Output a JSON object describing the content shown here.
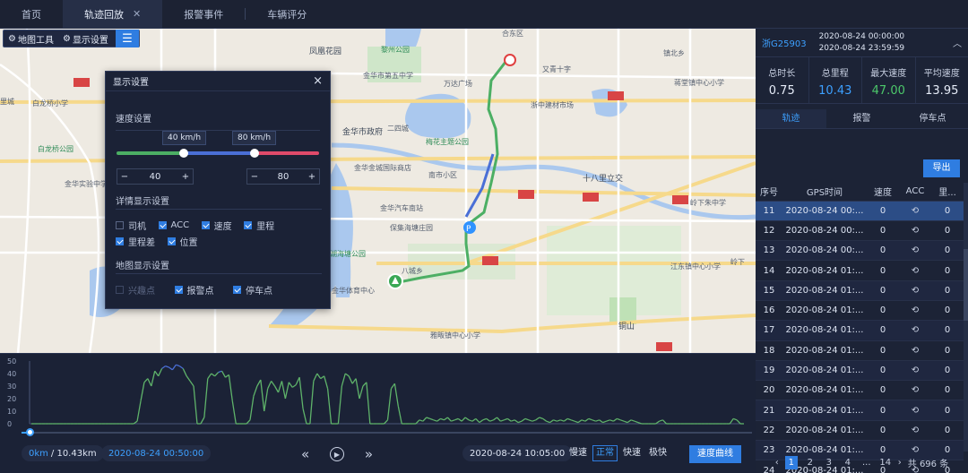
{
  "tabs": [
    {
      "label": "首页",
      "active": false
    },
    {
      "label": "轨迹回放",
      "active": true,
      "closable": true
    },
    {
      "label": "报警事件",
      "active": false
    },
    {
      "label": "车辆评分",
      "active": false
    }
  ],
  "map_toolbar": {
    "map_tools": "地图工具",
    "display_settings": "显示设置"
  },
  "map_labels": [
    "凤凰花园",
    "黎州公园",
    "合东区",
    "金华市第五中学",
    "又青十字",
    "万达广场",
    "浙中建材市场",
    "金华市政府",
    "二四城",
    "梅花主题公园",
    "金华金城国际商店",
    "南市小区",
    "十八里立交",
    "保集海塘庄园",
    "湖海塘公园",
    "金华汽车南站",
    "八城乡",
    "金华体育中心",
    "雅畈镇中心小学",
    "岭下朱中学",
    "岭下",
    "江东镇中心小学",
    "镇北乡",
    "铜山",
    "白龙桥小学",
    "金华实验中学",
    "白龙桥公园",
    "里城",
    "蒋堂镇中心小学"
  ],
  "settings_panel": {
    "title": "显示设置",
    "close": "×",
    "speed_title": "速度设置",
    "low_bubble": "40 km/h",
    "high_bubble": "80 km/h",
    "low_value": "40",
    "high_value": "80",
    "detail_title": "详情显示设置",
    "detail_items": [
      {
        "label": "司机",
        "checked": false
      },
      {
        "label": "ACC",
        "checked": true
      },
      {
        "label": "速度",
        "checked": true
      },
      {
        "label": "里程",
        "checked": true
      },
      {
        "label": "里程差",
        "checked": true
      },
      {
        "label": "位置",
        "checked": true
      }
    ],
    "map_title": "地图显示设置",
    "map_items": [
      {
        "label": "兴趣点",
        "checked": false,
        "disabled": true
      },
      {
        "label": "报警点",
        "checked": true
      },
      {
        "label": "停车点",
        "checked": true
      }
    ]
  },
  "vehicle": {
    "plate": "浙G25903",
    "start_time": "2020-08-24 00:00:00",
    "end_time": "2020-08-24 23:59:59"
  },
  "stats": [
    {
      "label": "总时长",
      "value": "0.75",
      "color": "#e6ecf8"
    },
    {
      "label": "总里程",
      "value": "10.43",
      "color": "#3da0ff"
    },
    {
      "label": "最大速度",
      "value": "47.00",
      "color": "#4cc76a"
    },
    {
      "label": "平均速度",
      "value": "13.95",
      "color": "#e6ecf8"
    }
  ],
  "panel_tabs": [
    {
      "label": "轨迹",
      "active": true
    },
    {
      "label": "报警",
      "active": false
    },
    {
      "label": "停车点",
      "active": false
    }
  ],
  "export_label": "导出",
  "table": {
    "headers": [
      "序号",
      "GPS时间",
      "速度",
      "ACC",
      "里..."
    ],
    "rows": [
      {
        "no": "11",
        "time": "2020-08-24 00:...",
        "speed": "0",
        "mileage": "0",
        "selected": true
      },
      {
        "no": "12",
        "time": "2020-08-24 00:...",
        "speed": "0",
        "mileage": "0"
      },
      {
        "no": "13",
        "time": "2020-08-24 00:...",
        "speed": "0",
        "mileage": "0"
      },
      {
        "no": "14",
        "time": "2020-08-24 01:...",
        "speed": "0",
        "mileage": "0"
      },
      {
        "no": "15",
        "time": "2020-08-24 01:...",
        "speed": "0",
        "mileage": "0"
      },
      {
        "no": "16",
        "time": "2020-08-24 01:...",
        "speed": "0",
        "mileage": "0"
      },
      {
        "no": "17",
        "time": "2020-08-24 01:...",
        "speed": "0",
        "mileage": "0"
      },
      {
        "no": "18",
        "time": "2020-08-24 01:...",
        "speed": "0",
        "mileage": "0"
      },
      {
        "no": "19",
        "time": "2020-08-24 01:...",
        "speed": "0",
        "mileage": "0"
      },
      {
        "no": "20",
        "time": "2020-08-24 01:...",
        "speed": "0",
        "mileage": "0"
      },
      {
        "no": "21",
        "time": "2020-08-24 01:...",
        "speed": "0",
        "mileage": "0"
      },
      {
        "no": "22",
        "time": "2020-08-24 01:...",
        "speed": "0",
        "mileage": "0"
      },
      {
        "no": "23",
        "time": "2020-08-24 01:...",
        "speed": "0",
        "mileage": "0"
      },
      {
        "no": "24",
        "time": "2020-08-24 01:...",
        "speed": "0",
        "mileage": "0"
      }
    ]
  },
  "pager": {
    "pages": [
      "1",
      "2",
      "3",
      "4",
      "...",
      "14"
    ],
    "active": "1",
    "total": "共 696 条"
  },
  "playback": {
    "mileage_progress": "0km",
    "mileage_total": "/ 10.43km",
    "current_time": "2020-08-24 00:50:00",
    "end_time": "2020-08-24 10:05:00",
    "speeds": [
      {
        "label": "慢速",
        "active": false
      },
      {
        "label": "正常",
        "active": true
      },
      {
        "label": "快速",
        "active": false
      },
      {
        "label": "极快",
        "active": false
      }
    ],
    "curve_button": "速度曲线",
    "progress": 0.02
  },
  "chart_data": {
    "type": "line",
    "title": "",
    "ylim": [
      0,
      50
    ],
    "yticks": [
      "50",
      "40",
      "30",
      "20",
      "10",
      "0"
    ],
    "series": [
      {
        "values": [
          0,
          0,
          0,
          0,
          0,
          0,
          0,
          0,
          0,
          0,
          0,
          0,
          0,
          0,
          0,
          0,
          0,
          0,
          0,
          0,
          0,
          0,
          0,
          0,
          0,
          0,
          0,
          0,
          0,
          0,
          2,
          18,
          33,
          36,
          30,
          42,
          38,
          44,
          46,
          45,
          43,
          47,
          46,
          44,
          38,
          34,
          30,
          0,
          0,
          5,
          36,
          40,
          38,
          41,
          42,
          37,
          39,
          18,
          0,
          0,
          0,
          0,
          3,
          22,
          30,
          35,
          10,
          28,
          34,
          30,
          25,
          34,
          20,
          33,
          29,
          31,
          37,
          12,
          0,
          0,
          34,
          40,
          36,
          38,
          28,
          0,
          0,
          0,
          30,
          40,
          38,
          32,
          36,
          20,
          30,
          33,
          0,
          0,
          0,
          0,
          0,
          3,
          28,
          32,
          14,
          0,
          0,
          0,
          0,
          0,
          3,
          2,
          5,
          4,
          3,
          2,
          4,
          3,
          5,
          2,
          3,
          4,
          2,
          5,
          3,
          2,
          4,
          1,
          3,
          4,
          2,
          3,
          5,
          2,
          3,
          4,
          2,
          3,
          1,
          2,
          4,
          3,
          2,
          3,
          5,
          4,
          2,
          1,
          3,
          2,
          3,
          2,
          4,
          3,
          2,
          1,
          3,
          2,
          4,
          3,
          2,
          3,
          1,
          2,
          3,
          2,
          4,
          3,
          2,
          1,
          3,
          2,
          1,
          0,
          0,
          0,
          0,
          0,
          2,
          3,
          0,
          0,
          0,
          0,
          0,
          0,
          0,
          0,
          0,
          0,
          0,
          0,
          0,
          0,
          0,
          0,
          0,
          0,
          0,
          4,
          3,
          0,
          0
        ]
      }
    ]
  },
  "colors": {
    "accent": "#2f7de1",
    "track": "#5fb36a",
    "speed_high": "#4a6fd6"
  }
}
